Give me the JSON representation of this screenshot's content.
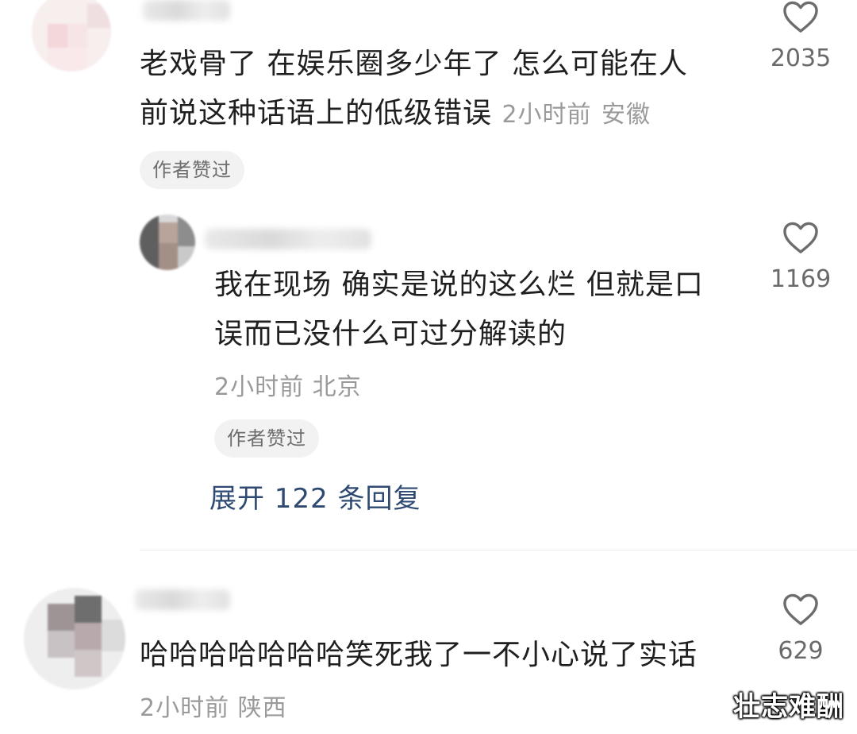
{
  "comments": [
    {
      "text": "老戏骨了 在娱乐圈多少年了 怎么可能在人前说这种话语上的低级错误",
      "text_line1": "老戏骨了 在娱乐圈多少年了 怎么可能在人",
      "text_line2": "前说这种话语上的低级错误",
      "time": "2小时前",
      "location": "安徽",
      "author_liked": "作者赞过",
      "likes": "2035"
    },
    {
      "text_line1": "我在现场 确实是说的这么烂 但就是口",
      "text_line2": "误而已没什么可过分解读的",
      "time": "2小时前",
      "location": "北京",
      "author_liked": "作者赞过",
      "likes": "1169",
      "expand_replies": "展开 122 条回复"
    },
    {
      "text_line1": "哈哈哈哈哈哈哈笑死我了一不小心说了实话",
      "time": "2小时前",
      "location": "陕西",
      "likes": "629"
    }
  ],
  "icons": {
    "like": "heart-outline-icon"
  },
  "watermark": "壮志难酬"
}
